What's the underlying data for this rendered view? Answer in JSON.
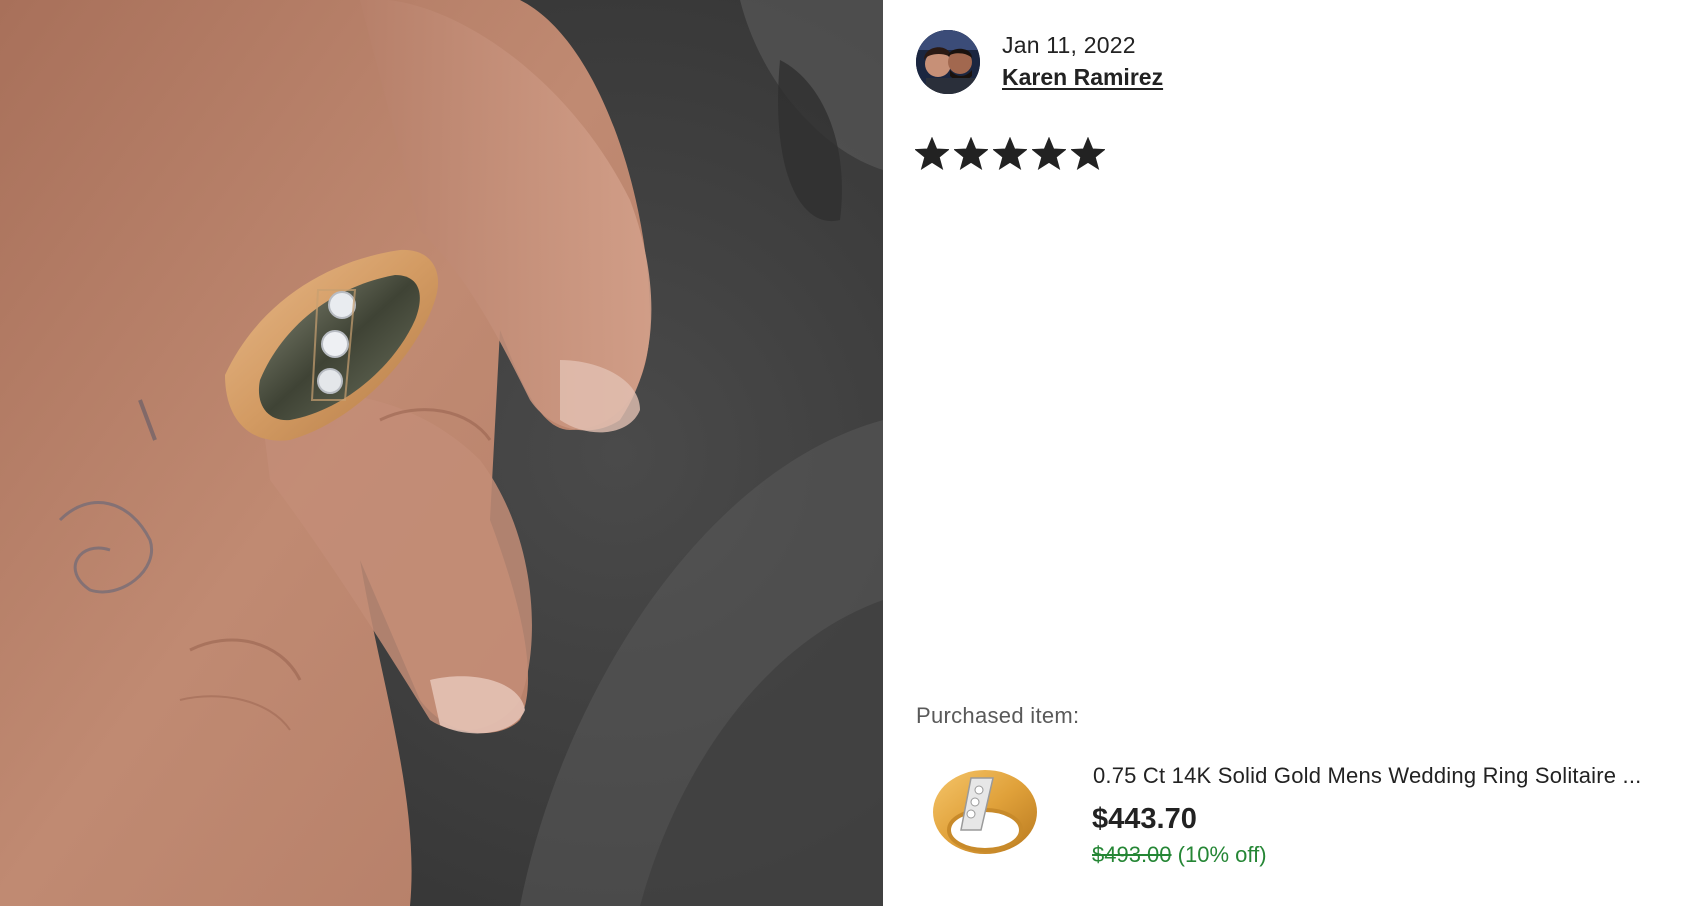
{
  "review": {
    "date": "Jan 11, 2022",
    "author": "Karen Ramirez",
    "rating": 5,
    "rating_max": 5
  },
  "purchase": {
    "label": "Purchased item:",
    "title": "0.75 Ct 14K Solid Gold Mens Wedding Ring Solitaire ...",
    "price": "$443.70",
    "original_price": "$493.00",
    "discount": "(10% off)"
  },
  "colors": {
    "text": "#222222",
    "muted": "#595959",
    "sale_green": "#258635",
    "star": "#222222"
  }
}
